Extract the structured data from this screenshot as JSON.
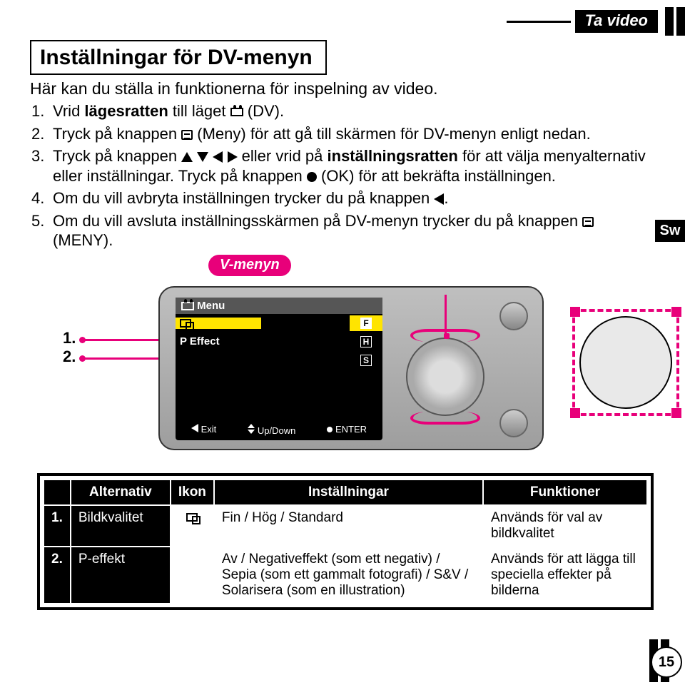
{
  "header": {
    "right_banner": "Ta video",
    "sw_tab": "Sw"
  },
  "title": "Inställningar för DV-menyn",
  "lead": "Här kan du ställa in funktionerna för inspelning av video.",
  "steps": {
    "s1a": "Vrid ",
    "s1b": "lägesratten",
    "s1c": " till läget ",
    "s1d": " (DV).",
    "s2a": "Tryck på knappen ",
    "s2b": " (Meny) för att gå till skärmen för DV-menyn enligt nedan.",
    "s3a": "Tryck på knappen ",
    "s3b": " eller vrid på ",
    "s3c": "inställningsratten",
    "s3d": " för att välja menyalternativ eller inställningar. Tryck på knappen ",
    "s3e": " (OK) för att bekräfta inställningen.",
    "s4a": "Om du vill avbryta inställningen trycker du på knappen ",
    "s4b": ".",
    "s5a": "Om du vill avsluta inställningsskärmen på DV-menyn trycker du på knappen ",
    "s5b": " (MENY)."
  },
  "vmenyn": "V-menyn",
  "camera": {
    "menu_title": "Menu",
    "row1": "",
    "row2": "P Effect",
    "badge_f": "F",
    "badge_h": "H",
    "badge_s": "S",
    "foot_exit": "Exit",
    "foot_updown": "Up/Down",
    "foot_enter": "ENTER"
  },
  "labels": {
    "l1": "1.",
    "l2": "2."
  },
  "table": {
    "headers": {
      "alt": "Alternativ",
      "ikon": "Ikon",
      "inst": "Inställningar",
      "funk": "Funktioner"
    },
    "rows": [
      {
        "num": "1.",
        "alt": "Bildkvalitet",
        "inst": "Fin / Hög / Standard",
        "funk": "Används för val av bildkvalitet"
      },
      {
        "num": "2.",
        "alt": "P-effekt",
        "inst": "Av / Negativeffekt (som ett negativ) / Sepia (som ett gammalt fotografi) / S&V / Solarisera (som en illustration)",
        "funk": "Används för att lägga till speciella effekter på bilderna"
      }
    ]
  },
  "page_number": "15"
}
